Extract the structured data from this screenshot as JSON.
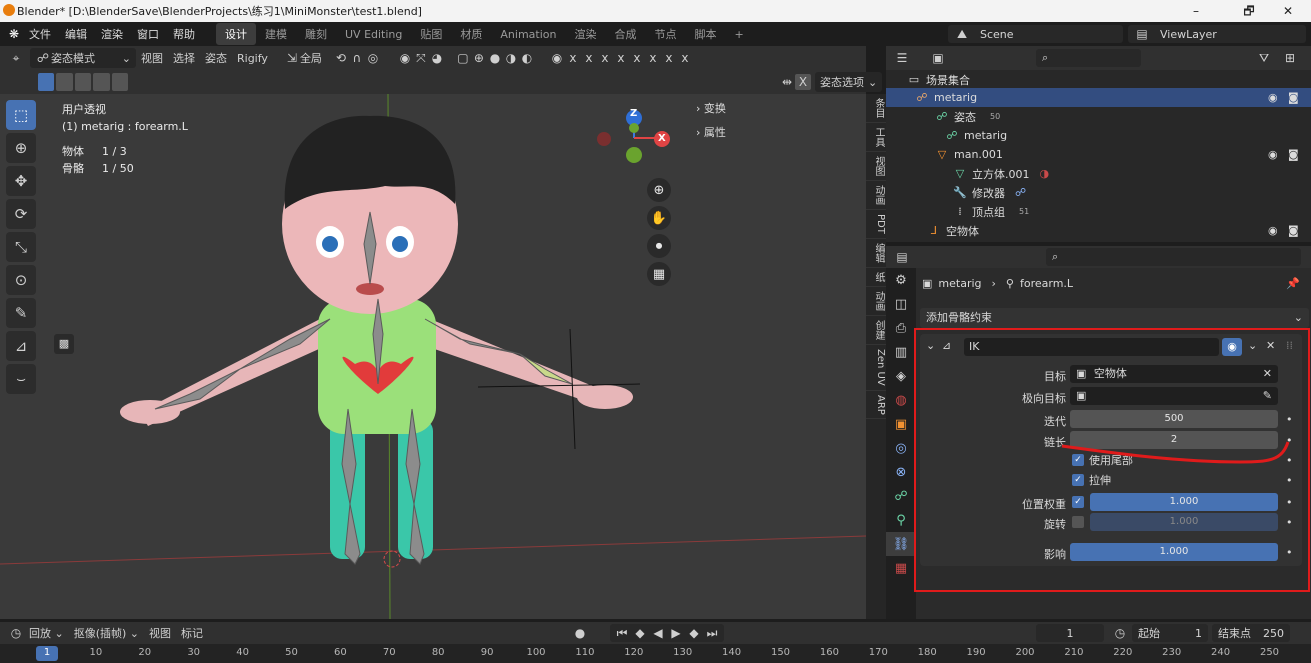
{
  "titlebar": {
    "title": "Blender* [D:\\BlenderSave\\BlenderProjects\\练习1\\MiniMonster\\test1.blend]",
    "minimize": "–",
    "maximize": "🗗",
    "close": "✕"
  },
  "menu": [
    "文件",
    "编辑",
    "渲染",
    "窗口",
    "帮助"
  ],
  "workspaces": [
    "设计",
    "建模",
    "雕刻",
    "UV Editing",
    "贴图",
    "材质",
    "Animation",
    "渲染",
    "合成",
    "节点",
    "脚本",
    "+"
  ],
  "scene": {
    "name": "Scene",
    "viewlayer": "ViewLayer"
  },
  "viewport_header": {
    "mode": "姿态模式",
    "items": [
      "视图",
      "选择",
      "姿态",
      "Rigify"
    ],
    "transform": "全局",
    "options": "姿态选项"
  },
  "viewport": {
    "view_name": "用户透视",
    "object_name": "(1) metarig : forearm.L",
    "stats": [
      {
        "label": "物体",
        "value": "1 / 3"
      },
      {
        "label": "骨骼",
        "value": "1 / 50"
      }
    ],
    "npanel": [
      "变换",
      "属性"
    ],
    "axes": {
      "z": "Z",
      "x": "X"
    }
  },
  "side_tabs": [
    "条目",
    "工具",
    "视图",
    "动画",
    "PDT",
    "编辑",
    "纸",
    "动画",
    "创建",
    "Zen UV",
    "ARP"
  ],
  "outliner": {
    "header": "场景集合",
    "rows": [
      {
        "label": "metarig",
        "selected": true
      },
      {
        "label": "姿态",
        "badge": "50"
      },
      {
        "label": "metarig"
      },
      {
        "label": "man.001"
      },
      {
        "label": "立方体.001"
      },
      {
        "label": "修改器"
      },
      {
        "label": "顶点组",
        "badge": "51"
      },
      {
        "label": "空物体"
      }
    ]
  },
  "properties": {
    "breadcrumb_obj": "metarig",
    "breadcrumb_bone": "forearm.L",
    "add_constraint": "添加骨骼约束",
    "constraint_name": "IK",
    "target_label": "目标",
    "target_value": "空物体",
    "pole_label": "极向目标",
    "iterations_label": "迭代",
    "iterations_value": "500",
    "chain_label": "链长",
    "chain_value": "2",
    "use_tail": "使用尾部",
    "stretch": "拉伸",
    "weight_pos_label": "位置权重",
    "weight_pos_value": "1.000",
    "rotation_label": "旋转",
    "rotation_value": "1.000",
    "influence_label": "影响",
    "influence_value": "1.000"
  },
  "timeline": {
    "playback": "回放",
    "keying": "抠像(插帧)",
    "view": "视图",
    "marker": "标记",
    "current_frame": "1",
    "start_label": "起始",
    "start": "1",
    "end_label": "结束点",
    "end": "250",
    "ruler": [
      "1",
      "10",
      "20",
      "30",
      "40",
      "50",
      "60",
      "70",
      "80",
      "90",
      "100",
      "110",
      "120",
      "130",
      "140",
      "150",
      "160",
      "170",
      "180",
      "190",
      "200",
      "210",
      "220",
      "230",
      "240",
      "250"
    ]
  },
  "colors": {
    "accent": "#4772b3",
    "annotation": "#e01b1b",
    "bone": "#8c8c8c"
  }
}
